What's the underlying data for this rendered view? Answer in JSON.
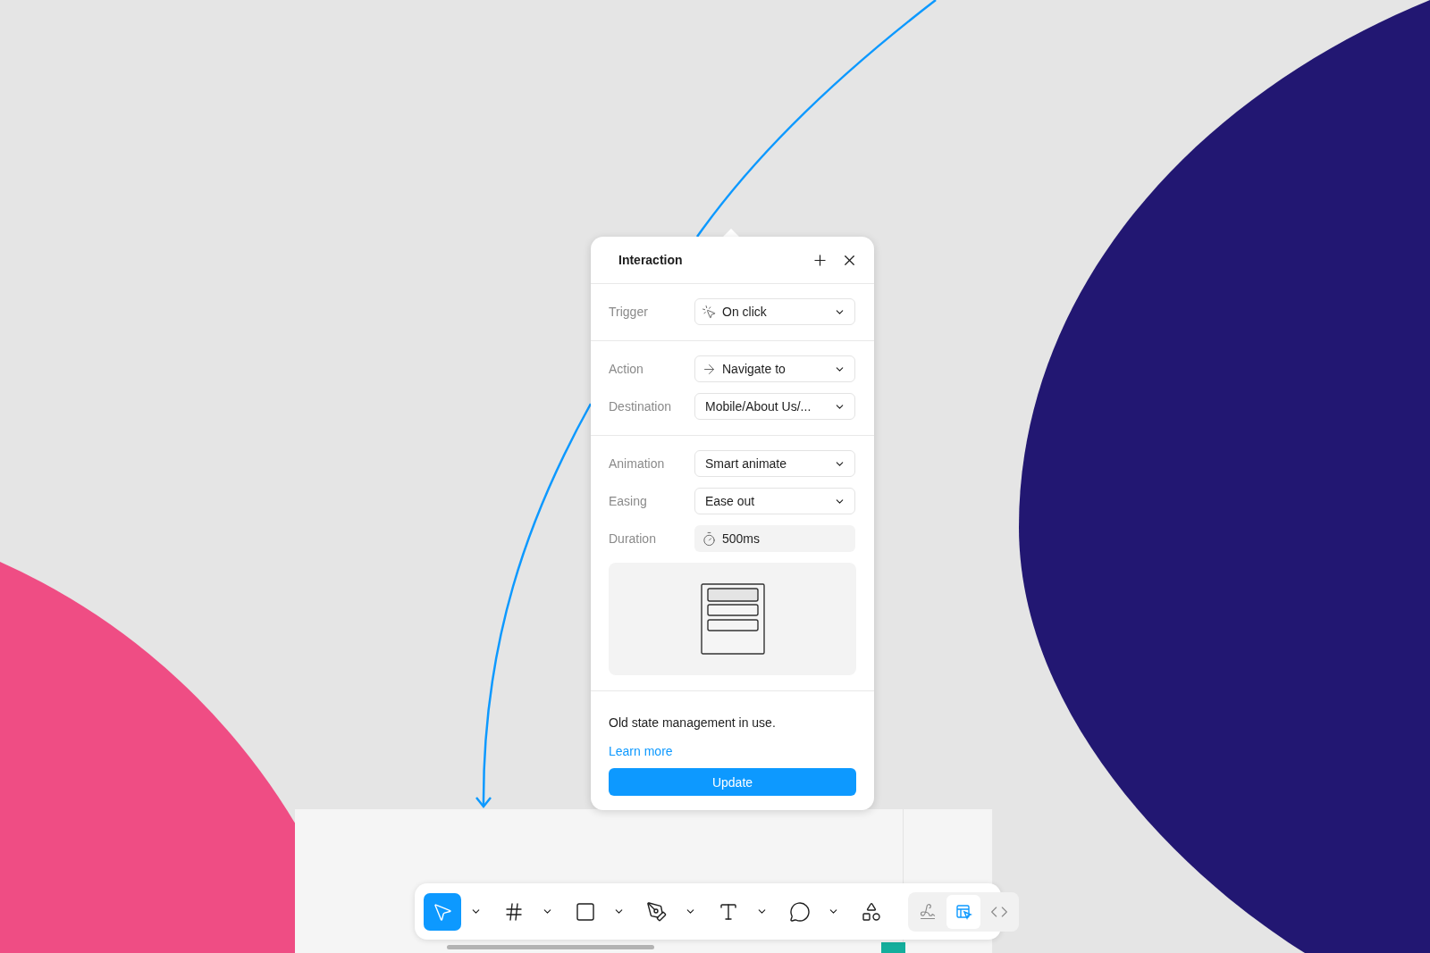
{
  "panel": {
    "title": "Interaction",
    "sections": [
      [
        {
          "label": "Trigger",
          "value": "On click",
          "kind": "click"
        }
      ],
      [
        {
          "label": "Action",
          "value": "Navigate to",
          "kind": "arrow"
        },
        {
          "label": "Destination",
          "value": "Mobile/About Us/...",
          "kind": "plain"
        }
      ],
      [
        {
          "label": "Animation",
          "value": "Smart animate",
          "kind": "plain"
        },
        {
          "label": "Easing",
          "value": "Ease out",
          "kind": "plain"
        },
        {
          "label": "Duration",
          "value": "500ms",
          "kind": "timer"
        }
      ]
    ],
    "preview": {
      "kind": "picture"
    },
    "notice": "Old state management in use.",
    "link": "Learn more",
    "button": "Update"
  },
  "toolbar": {
    "tools": [
      {
        "kind": "move",
        "selected": true,
        "menu": true
      },
      {
        "kind": "frame",
        "selected": false,
        "menu": true
      },
      {
        "kind": "shape",
        "selected": false,
        "menu": true
      },
      {
        "kind": "pen",
        "selected": false,
        "menu": true
      },
      {
        "kind": "text",
        "selected": false,
        "menu": true
      },
      {
        "kind": "comment",
        "selected": false,
        "menu": true
      },
      {
        "kind": "assets",
        "selected": false,
        "menu": false
      }
    ],
    "modes": [
      {
        "kind": "draw",
        "selected": false
      },
      {
        "kind": "design",
        "selected": true
      },
      {
        "kind": "dev",
        "selected": false
      }
    ]
  }
}
